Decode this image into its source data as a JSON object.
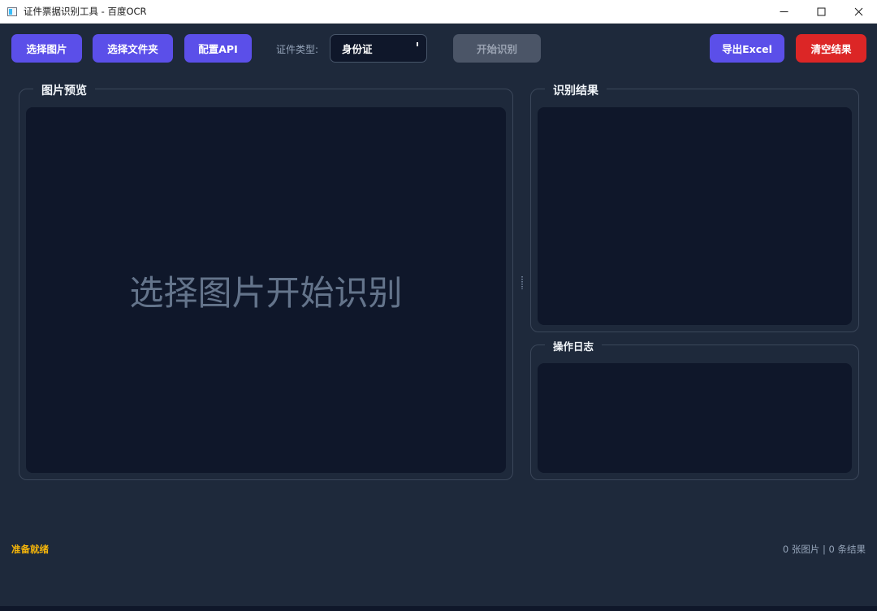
{
  "window": {
    "title": "证件票据识别工具 - 百度OCR"
  },
  "toolbar": {
    "select_image": "选择图片",
    "select_folder": "选择文件夹",
    "config_api": "配置API",
    "doc_type_label": "证件类型:",
    "doc_type_value": "身份证",
    "start": "开始识别",
    "export": "导出Excel",
    "clear": "清空结果"
  },
  "preview": {
    "title": "图片预览",
    "placeholder": "选择图片开始识别"
  },
  "results": {
    "title": "识别结果"
  },
  "log": {
    "title": "操作日志"
  },
  "status": {
    "message": "准备就绪",
    "counts": "0 张图片 | 0 条结果"
  },
  "colors": {
    "background": "#1e293b",
    "primary": "#5b4fe9",
    "danger": "#dc2626",
    "status_accent": "#f5b50a"
  }
}
